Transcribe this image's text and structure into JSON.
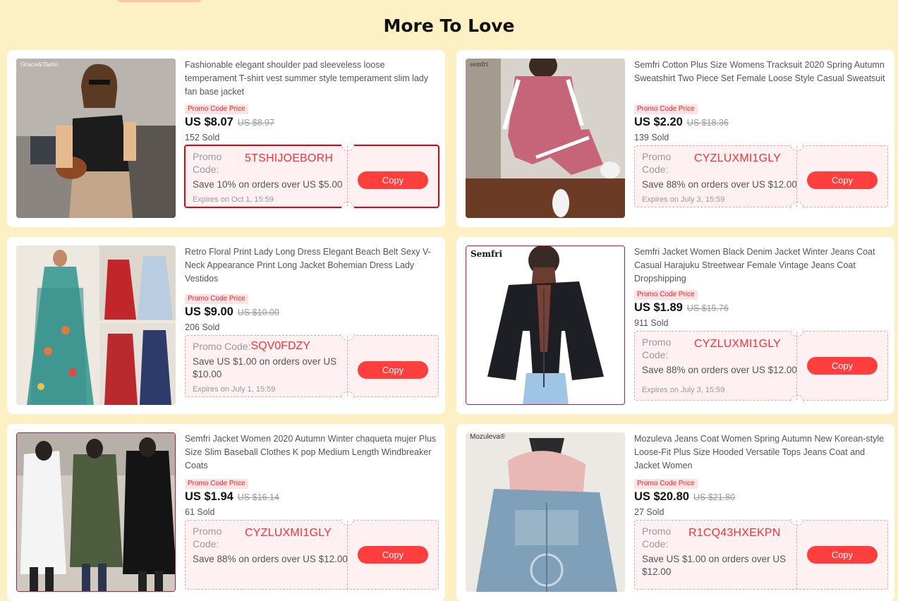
{
  "section_title": "More To Love",
  "products": [
    {
      "title": "Fashionable elegant shoulder pad sleeveless loose temperament T-shirt vest summer style temperament slim lady fan base jacket",
      "promo_tag": "Promo Code Price",
      "price": "US $8.07",
      "original_price": "US $8.97",
      "sold": "152 Sold",
      "thumb_brand": "Grace&Tasto",
      "coupon": {
        "code_label": "Promo Code:",
        "code": "5TSHIJOEBORH",
        "save": "Save 10% on orders over US $5.00",
        "expires": "Expires on Oct 1, 15:59",
        "copy_label": "Copy"
      }
    },
    {
      "title": "Semfri Cotton Plus Size Womens Tracksuit 2020 Spring Autumn Sweatshirt Two Piece Set Female Loose Style Casual Sweatsuit",
      "promo_tag": "Promo Code Price",
      "price": "US $2.20",
      "original_price": "US $18.36",
      "sold": "139 Sold",
      "thumb_brand": "semfri",
      "coupon": {
        "code_label": "Promo Code:",
        "code": "CYZLUXMI1GLY",
        "save": "Save 88% on orders over US $12.00",
        "expires": "Expires on July 3, 15:59",
        "copy_label": "Copy"
      }
    },
    {
      "title": "Retro Floral Print Lady Long Dress Elegant Beach Belt Sexy V-Neck Appearance Print Long Jacket Bohemian Dress Lady Vestidos",
      "promo_tag": "Promo Code Price",
      "price": "US $9.00",
      "original_price": "US $10.00",
      "sold": "206 Sold",
      "thumb_brand": "",
      "coupon": {
        "code_label": "Promo Code:",
        "code": "SQV0FDZY",
        "save": "Save US $1.00 on orders over US $10.00",
        "expires": "Expires on July 1, 15:59",
        "copy_label": "Copy"
      }
    },
    {
      "title": "Semfri Jacket Women Black Denim Jacket Winter Jeans Coat Casual Harajuku Streetwear Female Vintage Jeans Coat Dropshipping",
      "promo_tag": "Promo Code Price",
      "price": "US $1.89",
      "original_price": "US $15.76",
      "sold": "911 Sold",
      "thumb_brand": "Semfri",
      "coupon": {
        "code_label": "Promo Code:",
        "code": "CYZLUXMI1GLY",
        "save": "Save 88% on orders over US $12.00",
        "expires": "Expires on July 3, 15:59",
        "copy_label": "Copy"
      }
    },
    {
      "title": "Semfri Jacket Women 2020 Autumn Winter chaqueta mujer Plus Size Slim Baseball Clothes K pop Medium Length Windbreaker Coats",
      "promo_tag": "Promo Code Price",
      "price": "US $1.94",
      "original_price": "US $16.14",
      "sold": "61 Sold",
      "thumb_brand": "",
      "coupon": {
        "code_label": "Promo Code:",
        "code": "CYZLUXMI1GLY",
        "save": "Save 88% on orders over US $12.00",
        "expires": "",
        "copy_label": "Copy"
      }
    },
    {
      "title": "Mozuleva Jeans Coat Women Spring Autumn New Korean-style Loose-Fit Plus Size Hooded Versatile Tops Jeans Coat and Jacket Women",
      "promo_tag": "Promo Code Price",
      "price": "US $20.80",
      "original_price": "US $21.80",
      "sold": "27 Sold",
      "thumb_brand": "Mozuleva®",
      "coupon": {
        "code_label": "Promo Code:",
        "code": "R1CQ43HXEKPN",
        "save": "Save US $1.00 on orders over US $12.00",
        "expires": "",
        "copy_label": "Copy"
      }
    }
  ]
}
